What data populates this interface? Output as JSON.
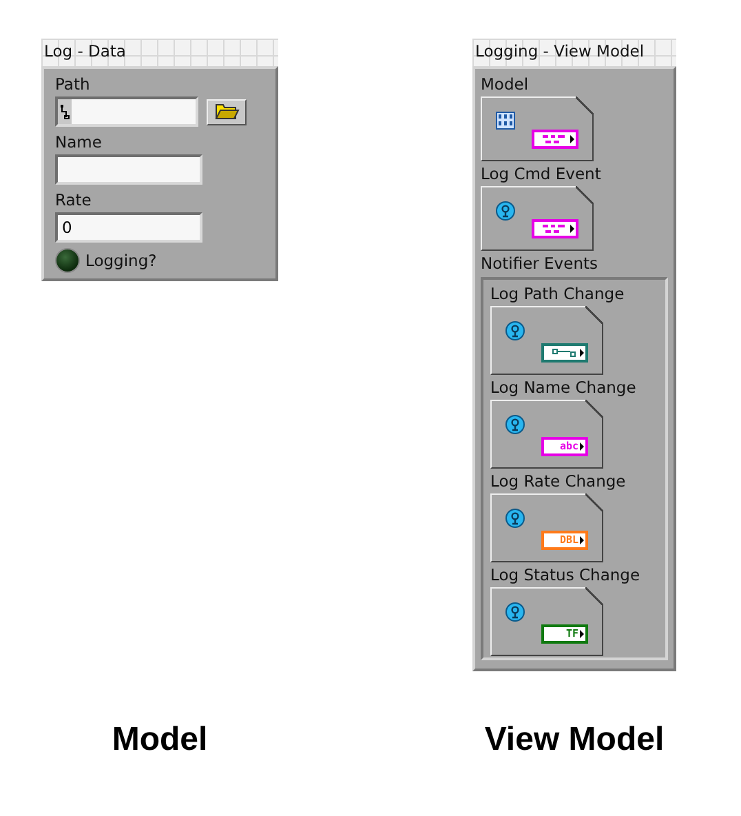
{
  "left": {
    "title": "Log - Data",
    "fields": [
      {
        "label": "Path",
        "kind": "path"
      },
      {
        "label": "Name",
        "kind": "text"
      },
      {
        "label": "Rate",
        "kind": "numeric",
        "value": "0"
      }
    ],
    "indicator": {
      "label": "Logging?",
      "on": false
    }
  },
  "right": {
    "title": "Logging - View Model",
    "items": [
      {
        "label": "Model",
        "kind": "reference",
        "terminal": {
          "kind": "cluster",
          "color": "#e600e6"
        }
      },
      {
        "label": "Log Cmd Event",
        "kind": "event",
        "terminal": {
          "kind": "cluster",
          "color": "#e600e6"
        }
      }
    ],
    "notifier": {
      "label": "Notifier Events",
      "items": [
        {
          "label": "Log Path Change",
          "kind": "event",
          "terminal": {
            "kind": "path",
            "color": "#1f7a70"
          }
        },
        {
          "label": "Log Name Change",
          "kind": "event",
          "terminal": {
            "kind": "string",
            "color": "#e600e6",
            "type_label": "abc"
          }
        },
        {
          "label": "Log Rate Change",
          "kind": "event",
          "terminal": {
            "kind": "numeric",
            "color": "#ff7a1a",
            "type_label": "DBL"
          }
        },
        {
          "label": "Log Status Change",
          "kind": "event",
          "terminal": {
            "kind": "boolean",
            "color": "#107a10",
            "type_label": "TF"
          }
        }
      ]
    }
  },
  "captions": [
    "Model",
    "View Model"
  ]
}
